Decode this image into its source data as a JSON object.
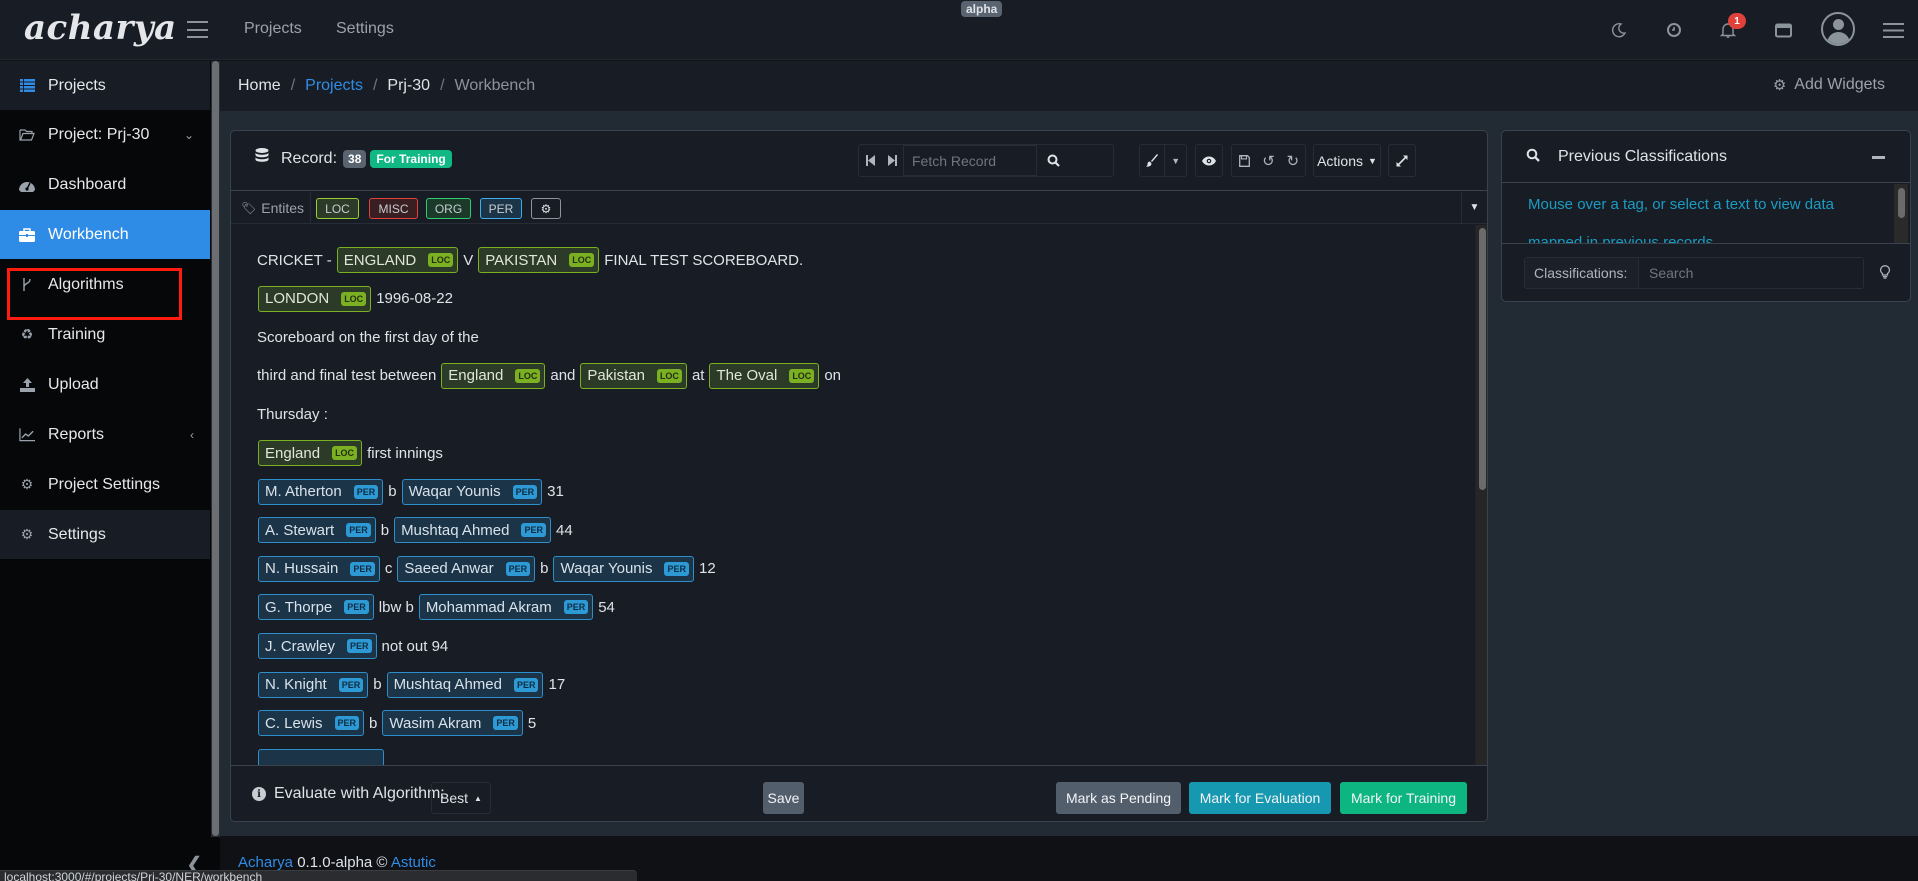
{
  "header": {
    "logo": "acharya",
    "nav": [
      "Projects",
      "Settings"
    ],
    "env_badge": "alpha",
    "notification_count": "1",
    "icons": [
      "moon-icon",
      "clock-icon",
      "bell-icon",
      "window-icon",
      "user-avatar-icon",
      "menu-icon"
    ]
  },
  "sidebar": {
    "items": [
      {
        "label": "Projects",
        "icon": "list-icon"
      },
      {
        "label": "Project: Prj-30",
        "icon": "folder-open-icon",
        "chevron": "down"
      },
      {
        "label": "Dashboard",
        "icon": "dashboard-gauge-icon"
      },
      {
        "label": "Workbench",
        "icon": "briefcase-icon",
        "active": true
      },
      {
        "label": "Algorithms",
        "icon": "code-branch-icon"
      },
      {
        "label": "Training",
        "icon": "recycle-icon"
      },
      {
        "label": "Upload",
        "icon": "upload-icon"
      },
      {
        "label": "Reports",
        "icon": "chart-line-icon",
        "chevron": "left"
      },
      {
        "label": "Project Settings",
        "icon": "gear-icon"
      },
      {
        "label": "Settings",
        "icon": "gears-icon"
      }
    ]
  },
  "breadcrumb": {
    "items": [
      "Home",
      "Projects",
      "Prj-30",
      "Workbench"
    ],
    "add_widgets": "Add Widgets"
  },
  "record": {
    "label": "Record:",
    "number": "38",
    "status": "For Training",
    "fetch_placeholder": "Fetch Record",
    "actions_label": "Actions"
  },
  "entities": {
    "label": "Entites",
    "tags": [
      {
        "name": "LOC",
        "color": "#9acd32"
      },
      {
        "name": "MISC",
        "color": "#e0413a"
      },
      {
        "name": "ORG",
        "color": "#2ecc71"
      },
      {
        "name": "PER",
        "color": "#3daee9"
      }
    ]
  },
  "document": {
    "lines": [
      [
        {
          "t": "CRICKET -"
        },
        {
          "e": "ENGLAND",
          "tag": "LOC"
        },
        {
          "t": "V"
        },
        {
          "e": "PAKISTAN",
          "tag": "LOC"
        },
        {
          "t": "FINAL TEST SCOREBOARD."
        }
      ],
      [
        {
          "e": "LONDON",
          "tag": "LOC"
        },
        {
          "t": "1996-08-22"
        }
      ],
      [
        {
          "t": "Scoreboard on the first day of the"
        }
      ],
      [
        {
          "t": "third and final test between"
        },
        {
          "e": "England",
          "tag": "LOC"
        },
        {
          "t": "and"
        },
        {
          "e": "Pakistan",
          "tag": "LOC"
        },
        {
          "t": "at"
        },
        {
          "e": "The Oval",
          "tag": "LOC"
        },
        {
          "t": "on"
        }
      ],
      [
        {
          "t": "Thursday :"
        }
      ],
      [
        {
          "e": "England",
          "tag": "LOC"
        },
        {
          "t": "first innings"
        }
      ],
      [
        {
          "e": "M. Atherton",
          "tag": "PER"
        },
        {
          "t": "b"
        },
        {
          "e": "Waqar Younis",
          "tag": "PER"
        },
        {
          "t": "31"
        }
      ],
      [
        {
          "e": "A. Stewart",
          "tag": "PER"
        },
        {
          "t": "b"
        },
        {
          "e": "Mushtaq Ahmed",
          "tag": "PER"
        },
        {
          "t": "44"
        }
      ],
      [
        {
          "e": "N. Hussain",
          "tag": "PER"
        },
        {
          "t": "c"
        },
        {
          "e": "Saeed Anwar",
          "tag": "PER"
        },
        {
          "t": "b"
        },
        {
          "e": "Waqar Younis",
          "tag": "PER"
        },
        {
          "t": "12"
        }
      ],
      [
        {
          "e": "G. Thorpe",
          "tag": "PER"
        },
        {
          "t": "lbw b"
        },
        {
          "e": "Mohammad Akram",
          "tag": "PER"
        },
        {
          "t": "54"
        }
      ],
      [
        {
          "e": "J. Crawley",
          "tag": "PER"
        },
        {
          "t": "not out 94"
        }
      ],
      [
        {
          "e": "N. Knight",
          "tag": "PER"
        },
        {
          "t": "b"
        },
        {
          "e": "Mushtaq Ahmed",
          "tag": "PER"
        },
        {
          "t": "17"
        }
      ],
      [
        {
          "e": "C. Lewis",
          "tag": "PER"
        },
        {
          "t": "b"
        },
        {
          "e": "Wasim Akram",
          "tag": "PER"
        },
        {
          "t": "5"
        }
      ]
    ]
  },
  "footer_actions": {
    "eval_label": "Evaluate with Algorithm:",
    "algorithm": "Best",
    "save": "Save",
    "mark_pending": "Mark as Pending",
    "mark_evaluation": "Mark for Evaluation",
    "mark_training": "Mark for Training",
    "colors": {
      "pending": "#535e6c",
      "evaluation": "#1798b1",
      "training": "#0db581"
    }
  },
  "prev_classifications": {
    "title": "Previous Classifications",
    "message": "Mouse over a tag, or select a text to view data mapped in previous records",
    "search_label": "Classifications:",
    "search_placeholder": "Search"
  },
  "page_footer": {
    "app": "Acharya",
    "version": "0.1.0-alpha ©",
    "company": "Astutic"
  },
  "status_url": "localhost:3000/#/projects/Prj-30/NER/workbench"
}
